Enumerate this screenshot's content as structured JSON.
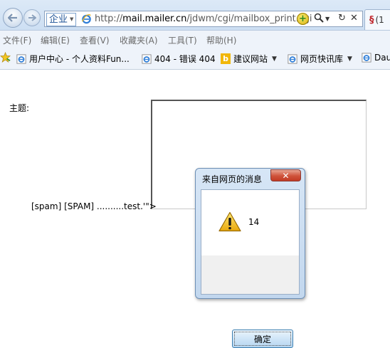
{
  "browser": {
    "zone_label": "企业",
    "url_prefix": "http://",
    "url_domain": "mail.mailer.cn",
    "url_path": "/jdwm/cgi/mailbox_print.cgi",
    "tab_label": "(1",
    "icons": {
      "back": "back-arrow-icon",
      "forward": "forward-arrow-icon",
      "search": "search-icon",
      "refresh": "refresh-icon",
      "stop": "close-icon"
    }
  },
  "menu": [
    "文件(F)",
    "编辑(E)",
    "查看(V)",
    "收藏夹(A)",
    "工具(T)",
    "帮助(H)"
  ],
  "favorites": [
    {
      "label": "用户中心 - 个人资料Fun...",
      "icon": "ie-page-icon",
      "has_menu": false
    },
    {
      "label": "404 - 错误 404",
      "icon": "ie-page-icon",
      "has_menu": false
    },
    {
      "label": "建议网站",
      "icon": "bing-icon",
      "has_menu": true
    },
    {
      "label": "网页快讯库",
      "icon": "ie-page-icon",
      "has_menu": true
    },
    {
      "label": "Dau",
      "icon": "ie-page-icon",
      "has_menu": false
    }
  ],
  "page": {
    "subject_label": "主题:",
    "spam_text": "[spam] [SPAM] ..........test.'\">"
  },
  "dialog": {
    "title": "来自网页的消息",
    "close_glyph": "✕",
    "message": "14",
    "ok_label": "确定"
  },
  "colors": {
    "titlebar": "#cddff3",
    "close_button": "#cf533a",
    "ok_button_border": "#3c7fb1"
  }
}
